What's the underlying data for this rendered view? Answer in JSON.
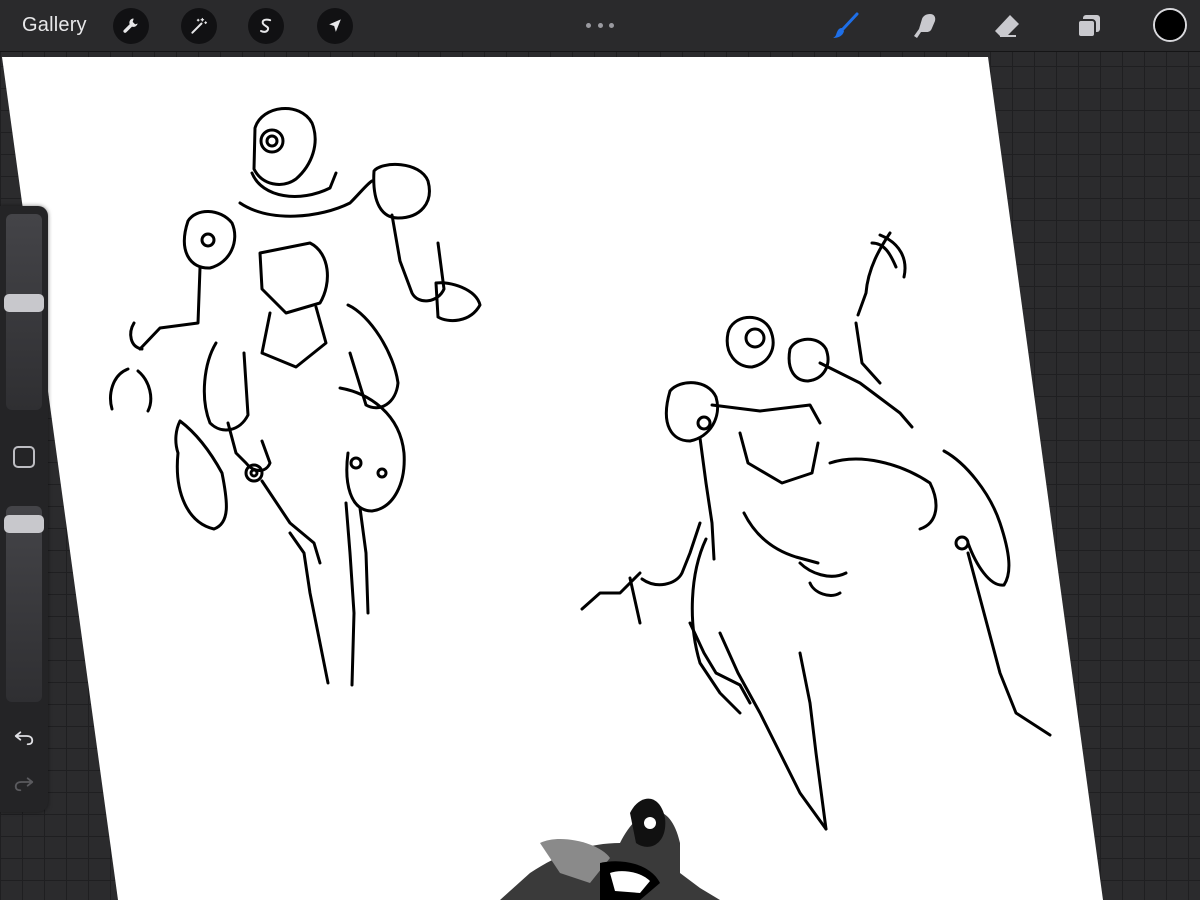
{
  "topbar": {
    "gallery_label": "Gallery",
    "left_tools": [
      {
        "name": "actions",
        "icon": "wrench-icon"
      },
      {
        "name": "adjustments",
        "icon": "magic-wand-icon"
      },
      {
        "name": "selection",
        "icon": "selection-s-icon"
      },
      {
        "name": "transform",
        "icon": "arrow-cursor-icon"
      }
    ],
    "more_icon": "more-dots-icon",
    "right_tools": [
      {
        "name": "brush",
        "icon": "brush-icon",
        "active": true
      },
      {
        "name": "smudge",
        "icon": "smudge-finger-icon",
        "active": false
      },
      {
        "name": "eraser",
        "icon": "eraser-icon",
        "active": false
      },
      {
        "name": "layers",
        "icon": "layers-icon",
        "active": false
      }
    ],
    "current_color": "#000000"
  },
  "sidebar": {
    "brush_size_level": 0.55,
    "brush_opacity_level": 0.95,
    "modify_icon": "square-modify-icon",
    "undo_icon": "undo-arrow-icon",
    "redo_icon": "redo-arrow-icon",
    "redo_enabled": false
  },
  "colors": {
    "accent_active": "#1e6fe8",
    "tool_idle": "#c9c9ce",
    "toolbar_bg": "#2a2a2c",
    "canvas_paper": "#ffffff",
    "background_grid": "#2b2b2d"
  }
}
